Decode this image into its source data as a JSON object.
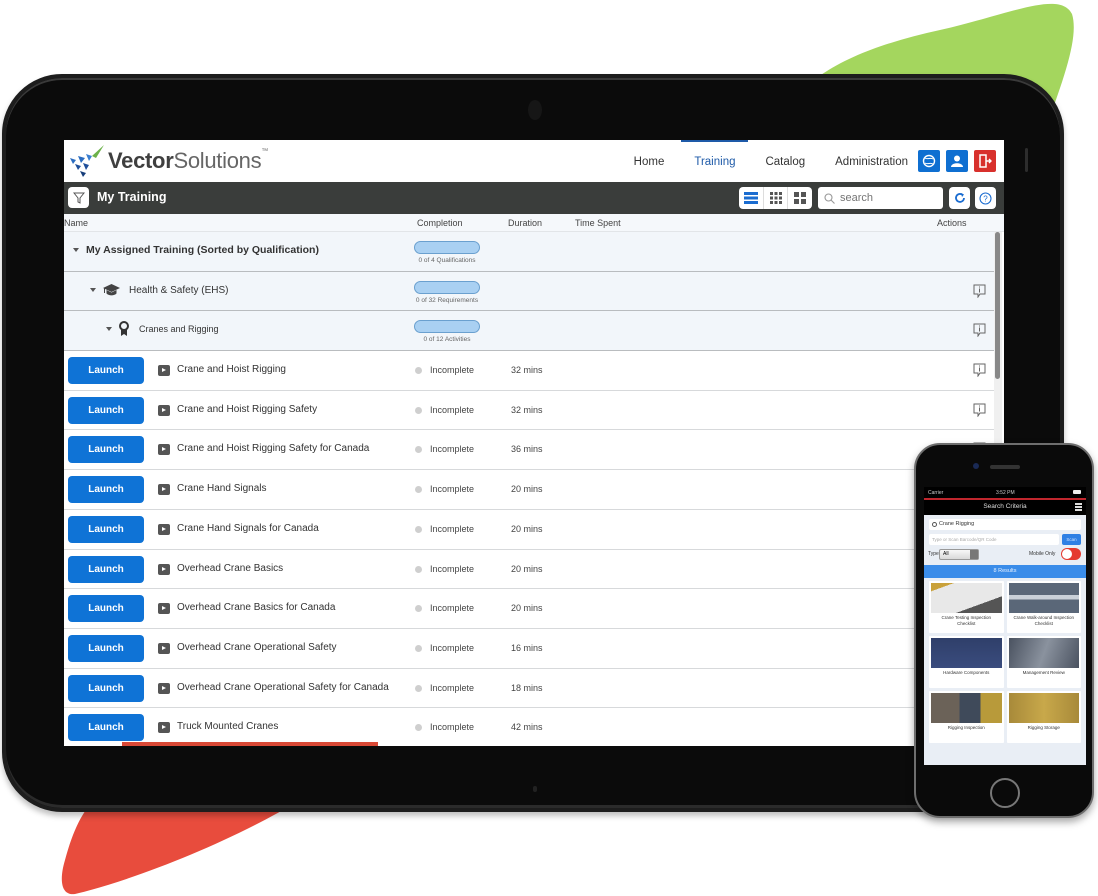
{
  "brand": {
    "logo_bold": "Vector",
    "logo_light": "Solutions",
    "trademark": "™"
  },
  "nav": {
    "items": [
      {
        "label": "Home",
        "active": false
      },
      {
        "label": "Training",
        "active": true
      },
      {
        "label": "Catalog",
        "active": false
      },
      {
        "label": "Administration",
        "active": false
      }
    ],
    "icons": [
      "globe-icon",
      "user-icon",
      "logout-icon"
    ]
  },
  "toolbar": {
    "title": "My Training",
    "search_placeholder": "search",
    "view_modes": [
      "list-view",
      "grid-small-view",
      "grid-large-view"
    ],
    "active_view": "list-view"
  },
  "columns": {
    "name": "Name",
    "completion": "Completion",
    "duration": "Duration",
    "time_spent": "Time Spent",
    "actions": "Actions"
  },
  "groups": [
    {
      "label": "My Assigned Training (Sorted by Qualification)",
      "progress_text": "0 of 4 Qualifications",
      "progress": 0
    },
    {
      "label": "Health & Safety (EHS)",
      "progress_text": "0 of 32 Requirements",
      "progress": 0
    },
    {
      "label": "Cranes and Rigging",
      "progress_text": "0 of 12 Activities",
      "progress": 0
    }
  ],
  "launch_label": "Launch",
  "courses": [
    {
      "name": "Crane and Hoist Rigging",
      "status": "Incomplete",
      "duration": "32 mins"
    },
    {
      "name": "Crane and Hoist Rigging Safety",
      "status": "Incomplete",
      "duration": "32 mins"
    },
    {
      "name": "Crane and Hoist Rigging Safety for Canada",
      "status": "Incomplete",
      "duration": "36 mins"
    },
    {
      "name": "Crane Hand Signals",
      "status": "Incomplete",
      "duration": "20 mins"
    },
    {
      "name": "Crane Hand Signals for Canada",
      "status": "Incomplete",
      "duration": "20 mins"
    },
    {
      "name": "Overhead Crane Basics",
      "status": "Incomplete",
      "duration": "20 mins"
    },
    {
      "name": "Overhead Crane Basics for Canada",
      "status": "Incomplete",
      "duration": "20 mins"
    },
    {
      "name": "Overhead Crane Operational Safety",
      "status": "Incomplete",
      "duration": "16 mins"
    },
    {
      "name": "Overhead Crane Operational Safety for Canada",
      "status": "Incomplete",
      "duration": "18 mins"
    },
    {
      "name": "Truck Mounted Cranes",
      "status": "Incomplete",
      "duration": "42 mins"
    }
  ],
  "phone": {
    "carrier": "Carrier",
    "time": "3:52 PM",
    "header": "Search Criteria",
    "search_value": "Crane Rigging",
    "scan_placeholder": "Type or Scan Barcode/QR Code",
    "scan_label": "Scan",
    "type_label": "Type",
    "type_value": "All",
    "mobile_only_label": "Mobile Only",
    "mobile_only": true,
    "results_label": "8 Results",
    "cards": [
      {
        "caption": "Crane Testing Inspection Checklist"
      },
      {
        "caption": "Crane Walk-around Inspection Checklist"
      },
      {
        "caption": "Hardware Components"
      },
      {
        "caption": "Management Review"
      },
      {
        "caption": "Rigging Inspection"
      },
      {
        "caption": "Rigging Storage"
      }
    ]
  },
  "colors": {
    "accent_blue": "#0f73d6",
    "nav_active": "#1e5aa8",
    "logout_red": "#d8302c",
    "titlebar": "#3a3d3b",
    "progress_fill": "#a9d0f2",
    "blob_green": "#a4d65e",
    "blob_red": "#e84c3d"
  }
}
